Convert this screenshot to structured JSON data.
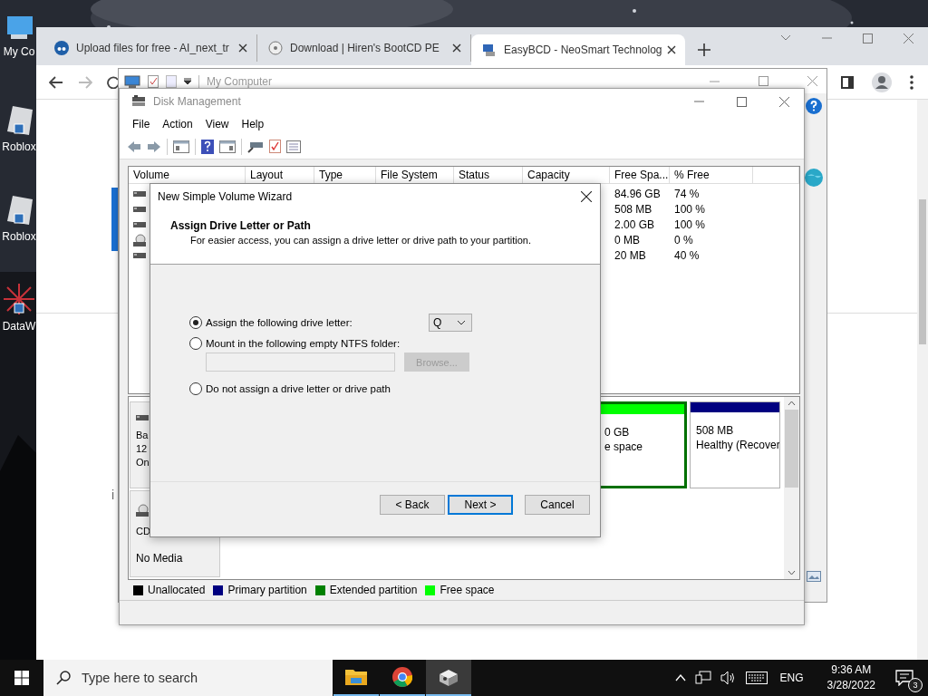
{
  "desktop": {
    "icons": [
      {
        "label": "My Co",
        "kind": "computer"
      },
      {
        "label": "Roblox",
        "kind": "roblox"
      },
      {
        "label": "Roblox",
        "kind": "roblox"
      },
      {
        "label": "DataW",
        "kind": "dataw"
      }
    ]
  },
  "browser": {
    "tabs": [
      {
        "title": "Upload files for free - AI_next_tr",
        "selected": false,
        "kind": "cloud"
      },
      {
        "title": "Download | Hiren's BootCD PE",
        "selected": false,
        "kind": "disc"
      },
      {
        "title": "EasyBCD - NeoSmart Technolog",
        "selected": true,
        "kind": "pc"
      }
    ],
    "page_text": [
      "i"
    ]
  },
  "my_computer": {
    "title": "My Computer"
  },
  "disk_management": {
    "title": "Disk Management",
    "menu": [
      "File",
      "Action",
      "View",
      "Help"
    ],
    "columns": [
      "Volume",
      "Layout",
      "Type",
      "File System",
      "Status",
      "Capacity",
      "Free Spa...",
      "% Free"
    ],
    "rows": [
      {
        "kind": "disk",
        "free_space": "84.96 GB",
        "percent_free": "74 %"
      },
      {
        "kind": "disk",
        "free_space": "508 MB",
        "percent_free": "100 %"
      },
      {
        "kind": "disk",
        "free_space": "2.00 GB",
        "percent_free": "100 %"
      },
      {
        "kind": "cd",
        "free_space": "0 MB",
        "percent_free": "0 %"
      },
      {
        "kind": "disk",
        "free_space": "20 MB",
        "percent_free": "40 %"
      }
    ],
    "disks": [
      {
        "kind": "disk",
        "info": [
          "Ba",
          "12",
          "On"
        ],
        "partitions": [
          {
            "kind": "free",
            "size": "0 GB",
            "status": "e space"
          },
          {
            "kind": "primary",
            "size": "508 MB",
            "status": "Healthy (Recover"
          }
        ]
      },
      {
        "kind": "cd",
        "info": [
          "CD"
        ],
        "media": "No Media"
      }
    ],
    "legend": [
      {
        "label": "Unallocated",
        "color": "#000000"
      },
      {
        "label": "Primary partition",
        "color": "#000080"
      },
      {
        "label": "Extended partition",
        "color": "#008000"
      },
      {
        "label": "Free space",
        "color": "#00ff00"
      }
    ]
  },
  "wizard": {
    "title": "New Simple Volume Wizard",
    "heading": "Assign Drive Letter or Path",
    "subtitle": "For easier access, you can assign a drive letter or drive path to your partition.",
    "options": [
      {
        "label": "Assign the following drive letter:",
        "selected": true,
        "kind": "letter"
      },
      {
        "label": "Mount in the following empty NTFS folder:",
        "selected": false,
        "kind": "folder"
      },
      {
        "label": "Do not assign a drive letter or drive path",
        "selected": false,
        "kind": "none"
      }
    ],
    "drive_letter": "Q",
    "browse": {
      "label": "Browse...",
      "disabled": true
    },
    "buttons": [
      {
        "label": "< Back",
        "default": false
      },
      {
        "label": "Next >",
        "default": true
      },
      {
        "label": "Cancel",
        "default": false
      }
    ]
  },
  "taskbar": {
    "search": {
      "placeholder": "Type here to search"
    },
    "apps": [
      {
        "kind": "explorer",
        "selected": false
      },
      {
        "kind": "chrome",
        "selected": false
      },
      {
        "kind": "app",
        "selected": true
      }
    ],
    "language": "ENG",
    "time": "9:36 AM",
    "date": "3/28/2022",
    "notifications": "3"
  }
}
